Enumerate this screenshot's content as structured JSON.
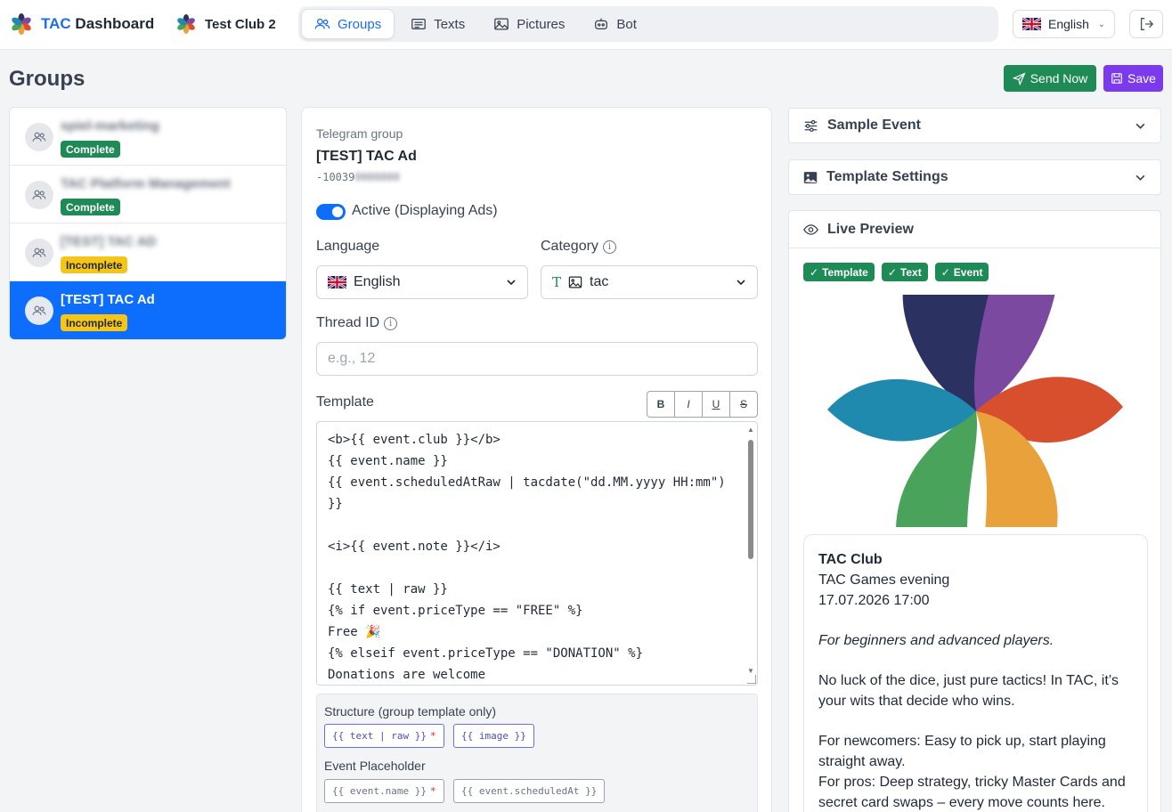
{
  "app": {
    "brand_accent": "TAC",
    "brand_rest": " Dashboard",
    "club_name": "Test Club 2"
  },
  "nav": {
    "tabs": [
      {
        "label": "Groups",
        "icon": "users-icon",
        "active": true
      },
      {
        "label": "Texts",
        "icon": "text-icon",
        "active": false
      },
      {
        "label": "Pictures",
        "icon": "image-icon",
        "active": false
      },
      {
        "label": "Bot",
        "icon": "bot-icon",
        "active": false
      }
    ],
    "language": "English"
  },
  "page": {
    "title": "Groups",
    "send_label": "Send Now",
    "save_label": "Save"
  },
  "groups": [
    {
      "name": "spiel-marketing",
      "status": "Complete",
      "blurred": true
    },
    {
      "name": "TAC Platform Management",
      "status": "Complete",
      "blurred": true
    },
    {
      "name": "[TEST] TAC AD",
      "status": "Incomplete",
      "blurred": true
    },
    {
      "name": "[TEST] TAC Ad",
      "status": "Incomplete",
      "blurred": false
    }
  ],
  "form": {
    "telegram_group_label": "Telegram group",
    "group_name": "[TEST] TAC Ad",
    "group_id_prefix": "-10039",
    "group_id_masked": "0000000",
    "active_label": "Active (Displaying Ads)",
    "language_label": "Language",
    "language_value": "English",
    "category_label": "Category",
    "category_value": "tac",
    "thread_label": "Thread ID",
    "thread_placeholder": "e.g., 12",
    "template_label": "Template",
    "format_buttons": [
      "B",
      "I",
      "U",
      "S"
    ],
    "template_text": "<b>{{ event.club }}</b>\n{{ event.name }}\n{{ event.scheduledAtRaw | tacdate(\"dd.MM.yyyy HH:mm\") }}\n\n<i>{{ event.note }}</i>\n\n{{ text | raw }}\n{% if event.priceType == \"FREE\" %}\nFree 🎉\n{% elseif event.priceType == \"DONATION\" %}\nDonations are welcome",
    "structure_label": "Structure (group template only)",
    "structure_chips": [
      "{{ text | raw }}",
      "{{ image }}"
    ],
    "event_placeholder_label": "Event Placeholder",
    "event_chips": [
      "{{ event.name }}",
      "{{ event.scheduledAt }}"
    ]
  },
  "right": {
    "sample_event": "Sample Event",
    "template_settings": "Template Settings",
    "live_preview": "Live Preview",
    "chips": [
      "Template",
      "Text",
      "Event"
    ],
    "preview": {
      "club": "TAC Club",
      "event_name": "TAC Games evening",
      "datetime": "17.07.2026 17:00",
      "note": "For beginners and advanced players.",
      "p1": "No luck of the dice, just pure tactics! In TAC, it’s your wits that decide who wins.",
      "p2": "For newcomers: Easy to pick up, start playing straight away.",
      "p3": "For pros: Deep strategy, tricky Master Cards and secret card swaps – every move counts here."
    }
  },
  "colors": {
    "primary": "#0d6efd",
    "success": "#1e8a55",
    "warning": "#f5c518",
    "purple": "#7c3aed"
  }
}
